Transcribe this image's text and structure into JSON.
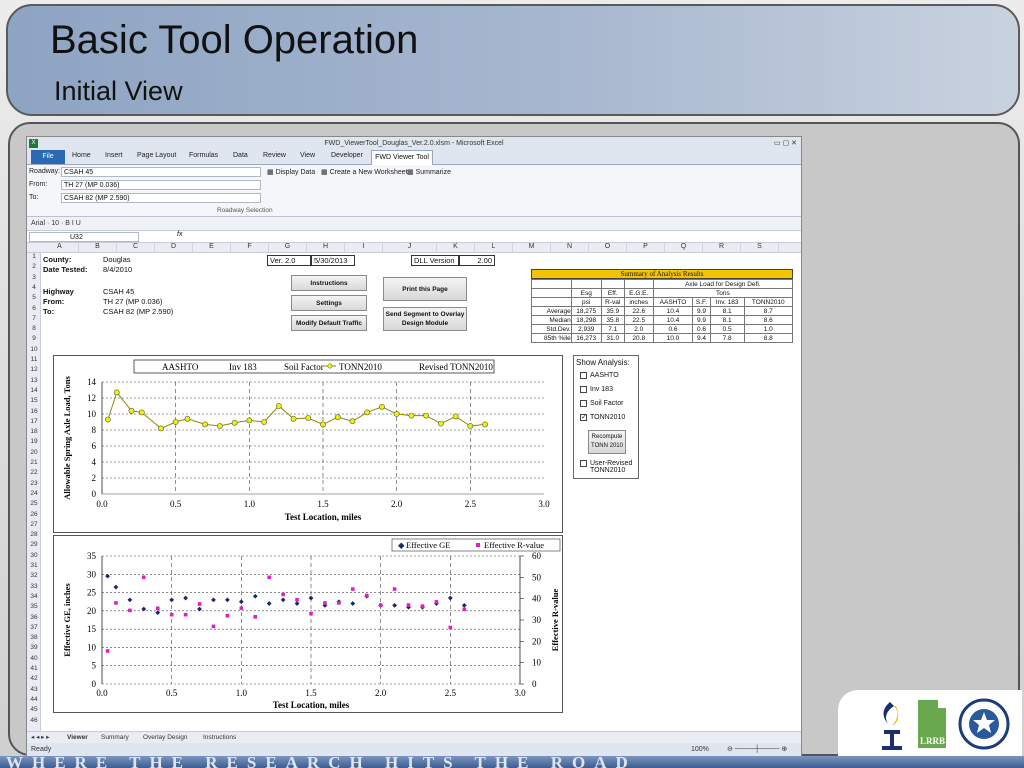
{
  "slide": {
    "title": "Basic Tool Operation",
    "subtitle": "Initial View",
    "banner": "WHERE THE RESEARCH HITS THE ROAD",
    "logo_lrrb": "LRRB"
  },
  "excel": {
    "window_title": "FWD_ViewerTool_Douglas_Ver.2.0.xlsm - Microsoft Excel",
    "tabs": [
      "File",
      "Home",
      "Insert",
      "Page Layout",
      "Formulas",
      "Data",
      "Review",
      "View",
      "Developer",
      "FWD Viewer Tool"
    ],
    "ribbon": {
      "roadway_label": "Roadway:",
      "roadway_value": "CSAH 45",
      "from_label": "From:",
      "from_value": "TH 27 (MP 0.036)",
      "to_label": "To:",
      "to_value": "CSAH 82 (MP 2.590)",
      "display_data": "Display Data",
      "create_ws": "Create a New Worksheet",
      "summarize": "Summarize",
      "group_label": "Roadway Selection"
    },
    "quick_access": "Arial · 10 · B I U",
    "name_box": "U32",
    "fx": "fx",
    "columns": [
      "A",
      "B",
      "C",
      "D",
      "E",
      "F",
      "G",
      "H",
      "I",
      "J",
      "K",
      "L",
      "M",
      "N",
      "O",
      "P",
      "Q",
      "R",
      "S"
    ],
    "rows": [
      "1",
      "2",
      "3",
      "4",
      "5",
      "6",
      "7",
      "8",
      "9",
      "10",
      "11",
      "12",
      "13",
      "14",
      "15",
      "16",
      "17",
      "18",
      "19",
      "20",
      "21",
      "22",
      "23",
      "24",
      "25",
      "26",
      "27",
      "28",
      "29",
      "30",
      "31",
      "32",
      "33",
      "34",
      "35",
      "36",
      "37",
      "38",
      "39",
      "40",
      "41",
      "42",
      "43",
      "44",
      "45",
      "46"
    ],
    "cells": {
      "county_l": "County:",
      "county_v": "Douglas",
      "date_l": "Date Tested:",
      "date_v": "8/4/2010",
      "hwy_l": "Highway",
      "hwy_v": "CSAH 45",
      "from_l": "From:",
      "from_v": "TH 27 (MP 0.036)",
      "to_l": "To:",
      "to_v": "CSAH 82 (MP 2.590)",
      "ver": "Ver. 2.0",
      "ver_date": "5/30/2013",
      "dll_l": "DLL Version",
      "dll_v": "2.00"
    },
    "buttons": {
      "instructions": "Instructions",
      "settings": "Settings",
      "modify": "Modify Default Traffic",
      "print": "Print this Page",
      "send": "Send Segment to Overlay Design Module"
    },
    "summary": {
      "title": "Summary of Analysis Results",
      "group": "Axle Load for Design Defl.",
      "tons": "Tons",
      "h1": [
        "Esg",
        "Eff.",
        "E.G.E."
      ],
      "h2": [
        "psi",
        "R-val",
        "inches",
        "AASHTO",
        "S.F.",
        "Inv. 183",
        "TONN2010"
      ],
      "rows": [
        {
          "label": "Average",
          "vals": [
            "18,275",
            "35.9",
            "22.6",
            "10.4",
            "9.9",
            "8.1",
            "8.7"
          ]
        },
        {
          "label": "Median",
          "vals": [
            "18,298",
            "35.8",
            "22.5",
            "10.4",
            "9.9",
            "8.1",
            "8.6"
          ]
        },
        {
          "label": "Std.Dev.",
          "vals": [
            "2,939",
            "7.1",
            "2.0",
            "0.6",
            "0.6",
            "0.5",
            "1.0"
          ]
        },
        {
          "label": "85th %ile",
          "vals": [
            "16,273",
            "31.0",
            "20.8",
            "10.0",
            "9.4",
            "7.8",
            "8.8"
          ]
        }
      ]
    },
    "panel": {
      "title": "Show Analysis:",
      "options": [
        {
          "label": "AASHTO",
          "checked": ""
        },
        {
          "label": "Inv 183",
          "checked": ""
        },
        {
          "label": "Soil Factor",
          "checked": ""
        },
        {
          "label": "TONN2010",
          "checked": "✓"
        }
      ],
      "recompute": "Recompute TONN 2010",
      "revised": "User-Revised TONN2010",
      "revised_checked": ""
    },
    "sheet_tabs": [
      "Viewer",
      "Summary",
      "Overlay Design",
      "Instructions"
    ],
    "status": {
      "ready": "Ready",
      "zoom": "100%"
    }
  },
  "chart_data": [
    {
      "type": "line",
      "legend": [
        "AASHTO",
        "Inv 183",
        "Soil Factor",
        "TONN2010",
        "Revised TONN2010"
      ],
      "xlabel": "Test Location, miles",
      "ylabel": "Allowable Spring Axle Load, Tons",
      "xlim": [
        0,
        3.0
      ],
      "ylim": [
        0,
        14
      ],
      "xticks": [
        "0.0",
        "0.5",
        "1.0",
        "1.5",
        "2.0",
        "2.5",
        "3.0"
      ],
      "yticks": [
        "0",
        "2",
        "4",
        "6",
        "8",
        "10",
        "12",
        "14"
      ],
      "series": [
        {
          "name": "TONN2010",
          "color": "#c8c800",
          "x": [
            0.04,
            0.1,
            0.2,
            0.27,
            0.4,
            0.5,
            0.58,
            0.7,
            0.8,
            0.9,
            1.0,
            1.1,
            1.2,
            1.3,
            1.4,
            1.5,
            1.6,
            1.7,
            1.8,
            1.9,
            2.0,
            2.1,
            2.2,
            2.3,
            2.4,
            2.5,
            2.6
          ],
          "y": [
            9.3,
            12.7,
            10.4,
            10.2,
            8.2,
            9.0,
            9.4,
            8.7,
            8.5,
            8.9,
            9.2,
            9.0,
            11.0,
            9.4,
            9.5,
            8.7,
            9.6,
            9.1,
            10.2,
            10.9,
            10.0,
            9.8,
            9.8,
            8.8,
            9.7,
            8.5,
            8.7
          ]
        }
      ]
    },
    {
      "type": "scatter",
      "legend": [
        "Effective GE",
        "Effective R-value"
      ],
      "xlabel": "Test Location, miles",
      "ylabel": "Effective GE, inches",
      "y2label": "Effective R-value",
      "xlim": [
        0,
        3.0
      ],
      "ylim": [
        0,
        35
      ],
      "y2lim": [
        0,
        60
      ],
      "xticks": [
        "0.0",
        "0.5",
        "1.0",
        "1.5",
        "2.0",
        "2.5",
        "3.0"
      ],
      "yticks": [
        "0",
        "5",
        "10",
        "15",
        "20",
        "25",
        "30",
        "35"
      ],
      "y2ticks": [
        "0",
        "10",
        "20",
        "30",
        "40",
        "50",
        "60"
      ],
      "series": [
        {
          "name": "Effective GE",
          "color": "#1c2a6b",
          "x": [
            0.04,
            0.1,
            0.2,
            0.3,
            0.4,
            0.5,
            0.6,
            0.7,
            0.8,
            0.9,
            1.0,
            1.1,
            1.2,
            1.3,
            1.4,
            1.5,
            1.6,
            1.7,
            1.8,
            1.9,
            2.0,
            2.1,
            2.2,
            2.3,
            2.4,
            2.5,
            2.6
          ],
          "y": [
            29.5,
            26.5,
            23.0,
            20.5,
            19.5,
            23.0,
            23.5,
            20.5,
            23.0,
            23.0,
            22.5,
            24.0,
            22.0,
            23.0,
            22.0,
            23.5,
            21.5,
            22.5,
            22.0,
            24.0,
            21.5,
            21.5,
            21.0,
            21.0,
            22.0,
            23.5,
            21.5
          ]
        },
        {
          "name": "Effective R-value",
          "color": "#e020c0",
          "x": [
            0.04,
            0.1,
            0.2,
            0.3,
            0.4,
            0.5,
            0.6,
            0.7,
            0.8,
            0.9,
            1.0,
            1.1,
            1.2,
            1.3,
            1.4,
            1.5,
            1.6,
            1.7,
            1.8,
            1.9,
            2.0,
            2.1,
            2.2,
            2.3,
            2.4,
            2.5,
            2.6
          ],
          "y": [
            15.5,
            38.0,
            34.5,
            50.0,
            35.5,
            32.5,
            32.5,
            37.5,
            27.0,
            32.0,
            35.5,
            31.5,
            50.0,
            42.0,
            39.5,
            33.0,
            38.0,
            38.0,
            44.5,
            41.5,
            37.0,
            44.5,
            37.0,
            36.5,
            38.5,
            26.5,
            35.0
          ]
        }
      ]
    }
  ]
}
